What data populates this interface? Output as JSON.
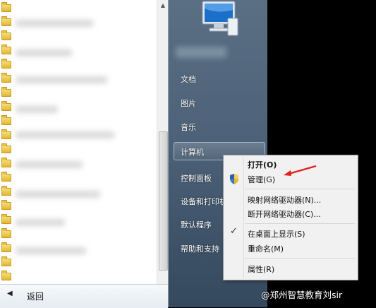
{
  "start_menu": {
    "back_label": "返回",
    "right_items": {
      "documents": "文档",
      "pictures": "图片",
      "music": "音乐",
      "computer": "计算机",
      "control_panel": "控制面板",
      "devices_printers": "设备和打印机",
      "default_programs": "默认程序",
      "help_support": "帮助和支持"
    }
  },
  "context_menu": {
    "open": "打开(O)",
    "manage": "管理(G)",
    "map_drive": "映射网络驱动器(N)...",
    "disconnect_drive": "断开网络驱动器(C)...",
    "show_on_desktop": "在桌面上显示(S)",
    "rename": "重命名(M)",
    "properties": "属性(R)"
  },
  "watermark": "@郑州智慧教育刘sir",
  "colors": {
    "annotation_arrow": "#e0221b",
    "right_pane": "#4d6278"
  }
}
